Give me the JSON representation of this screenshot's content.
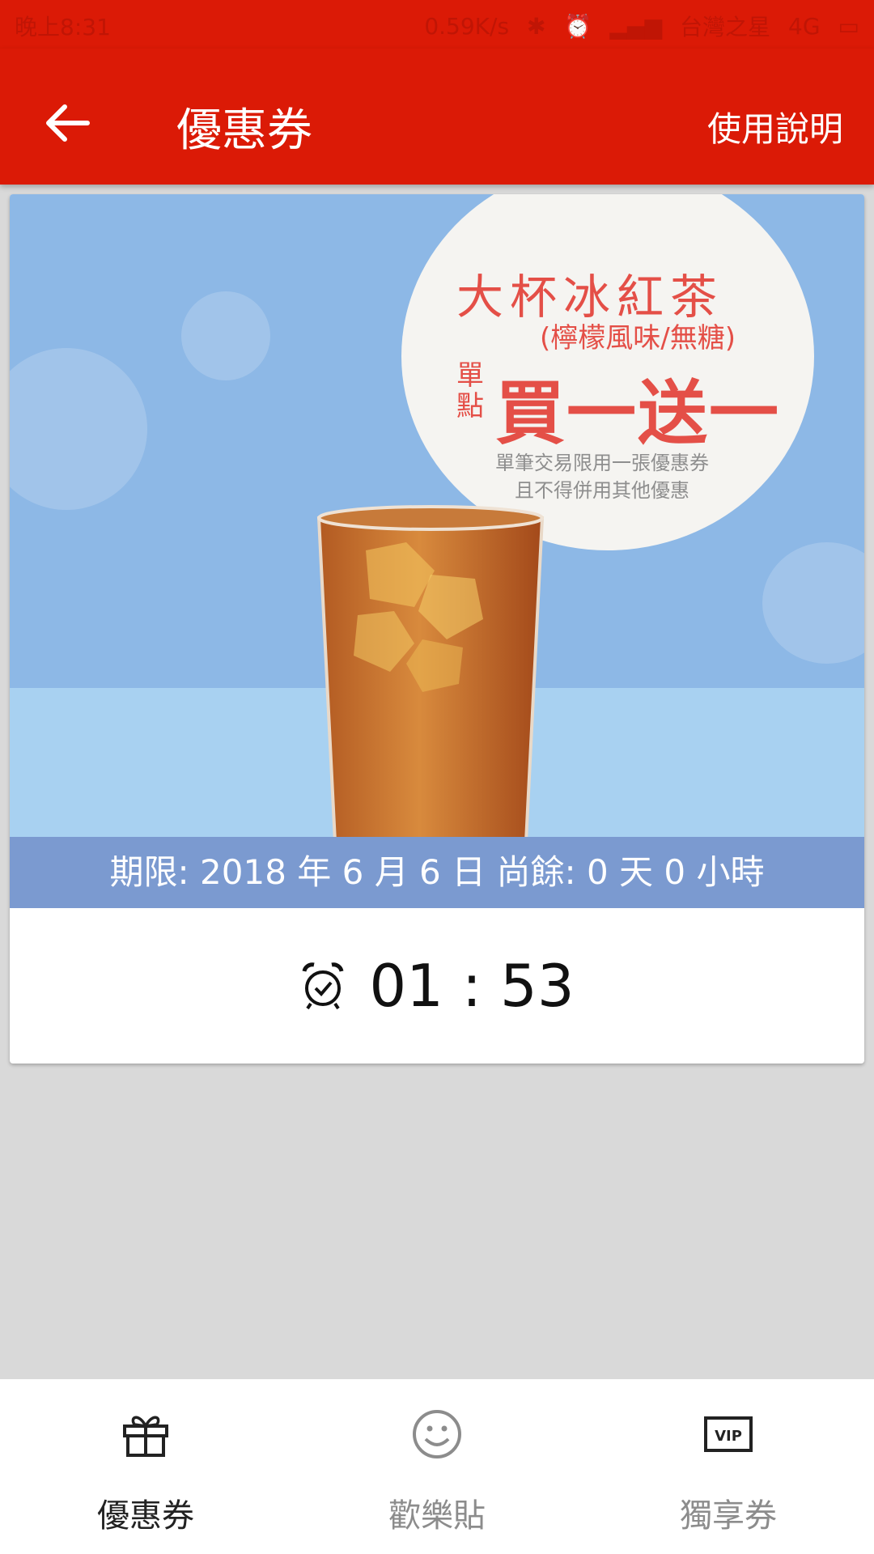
{
  "status_bar": {
    "time": "晚上8:31",
    "speed": "0.59K/s",
    "carrier": "台灣之星",
    "network": "4G"
  },
  "app_bar": {
    "title": "優惠券",
    "help_label": "使用說明",
    "back_icon": "arrow-left-icon",
    "color": "#db1a06"
  },
  "coupon": {
    "promo": {
      "title": "大杯冰紅茶",
      "subtitle": "(檸檬風味/無糖)",
      "order_note": "單點",
      "offer": "買一送一",
      "note_line1": "單筆交易限用一張優惠券",
      "note_line2": "且不得併用其他優惠"
    },
    "expiry_text": "期限: 2018 年 6 月 6 日 尚餘: 0 天 0 小時",
    "timer_icon": "alarm-clock-icon",
    "timer": "01 : 53"
  },
  "bottom_nav": {
    "items": [
      {
        "label": "優惠券",
        "icon": "gift-icon",
        "active": true
      },
      {
        "label": "歡樂貼",
        "icon": "smiley-icon",
        "active": false
      },
      {
        "label": "獨享券",
        "icon": "vip-icon",
        "active": false
      }
    ]
  }
}
